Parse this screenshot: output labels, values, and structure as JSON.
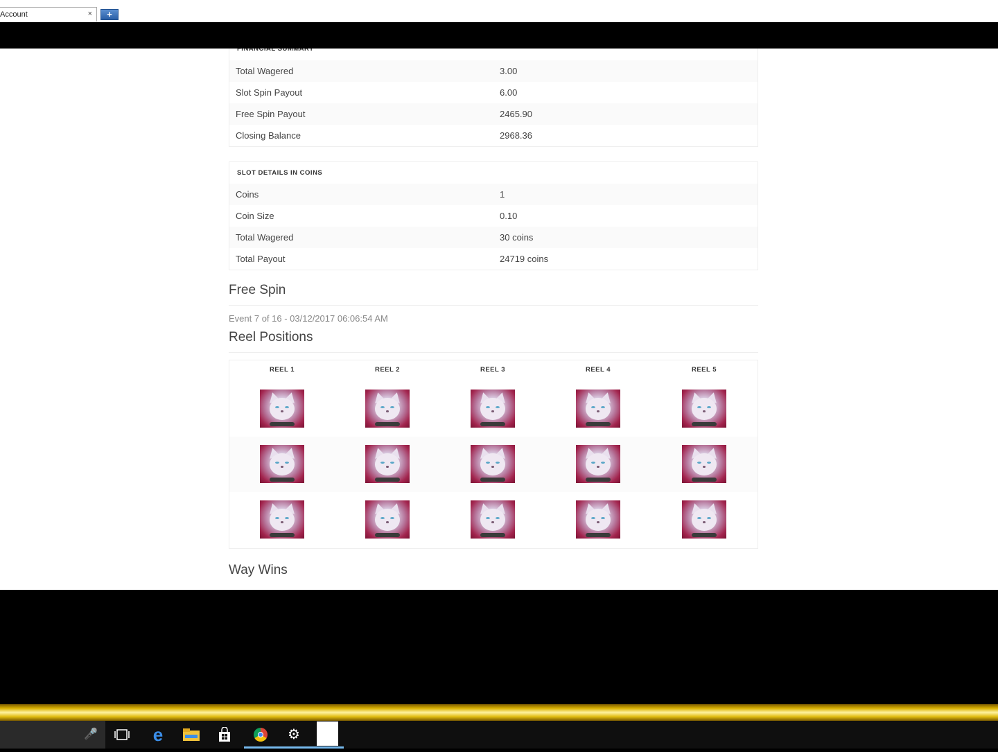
{
  "browser": {
    "tab_title": "Account",
    "tab_close": "×",
    "new_tab": "+"
  },
  "financial_summary": {
    "heading": "FINANCIAL SUMMARY",
    "rows": [
      {
        "label": "Total Wagered",
        "value": "3.00"
      },
      {
        "label": "Slot Spin Payout",
        "value": "6.00"
      },
      {
        "label": "Free Spin Payout",
        "value": "2465.90"
      },
      {
        "label": "Closing Balance",
        "value": "2968.36"
      }
    ]
  },
  "slot_details": {
    "heading": "SLOT DETAILS IN COINS",
    "rows": [
      {
        "label": "Coins",
        "value": "1"
      },
      {
        "label": "Coin Size",
        "value": "0.10"
      },
      {
        "label": "Total Wagered",
        "value": "30 coins"
      },
      {
        "label": "Total Payout",
        "value": "24719 coins"
      }
    ]
  },
  "free_spin": {
    "title": "Free Spin",
    "event": "Event 7 of 16 - 03/12/2017 06:06:54 AM"
  },
  "reel_positions": {
    "title": "Reel Positions",
    "reels": [
      "REEL 1",
      "REEL 2",
      "REEL 3",
      "REEL 4",
      "REEL 5"
    ],
    "symbol": "white-cat-symbol"
  },
  "way_wins": {
    "title": "Way Wins"
  },
  "taskbar": {
    "icons": [
      "microphone-icon",
      "task-view-icon",
      "edge-icon",
      "file-explorer-icon",
      "store-icon",
      "chrome-icon",
      "settings-icon",
      "blank-app-icon"
    ]
  }
}
